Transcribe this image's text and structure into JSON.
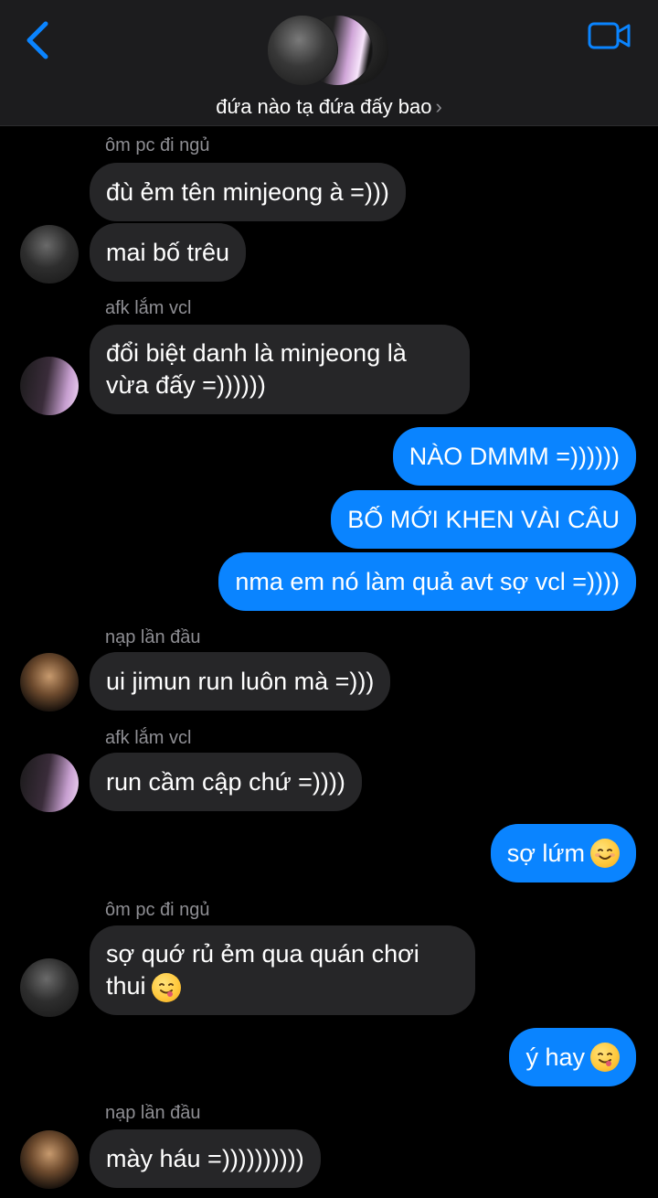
{
  "header": {
    "group_name": "đứa nào tạ đứa đấy bao",
    "chevron": "›",
    "back_icon": "chevron-left-icon",
    "video_icon": "video-camera-icon"
  },
  "colors": {
    "accent": "#0a84ff",
    "incoming_bubble": "#262628",
    "background": "#000000",
    "sender_label": "#8e8e93"
  },
  "messages": [
    {
      "sender": "ôm pc đi ngủ",
      "text": "đù ẻm tên minjeong à =)))",
      "direction": "in"
    },
    {
      "text": "mai bố trêu",
      "direction": "in"
    },
    {
      "sender": "afk lắm vcl",
      "text": "đổi biệt danh là minjeong là\nvừa đấy =))))))",
      "direction": "in"
    },
    {
      "text": "NÀO DMMM =))))))",
      "direction": "out"
    },
    {
      "text": "BỐ MỚI KHEN VÀI CÂU",
      "direction": "out"
    },
    {
      "text": "nma em nó làm quả avt sợ vcl =))))",
      "direction": "out"
    },
    {
      "sender": "nạp lần đầu",
      "text": "ui jimun run luôn mà =)))",
      "direction": "in"
    },
    {
      "sender": "afk lắm vcl",
      "text": "run cầm cập chứ =))))",
      "direction": "in"
    },
    {
      "text": "sợ lứm",
      "emoji": "smiling-face-icon",
      "direction": "out"
    },
    {
      "sender": "ôm pc đi ngủ",
      "text": "sợ quớ rủ ẻm qua quán chơi\nthui",
      "emoji": "yum-face-icon",
      "direction": "in"
    },
    {
      "text": "ý hay",
      "emoji": "yum-face-icon",
      "direction": "out"
    },
    {
      "sender": "nạp lần đầu",
      "text": "mày háu =))))))))))",
      "direction": "in"
    }
  ]
}
